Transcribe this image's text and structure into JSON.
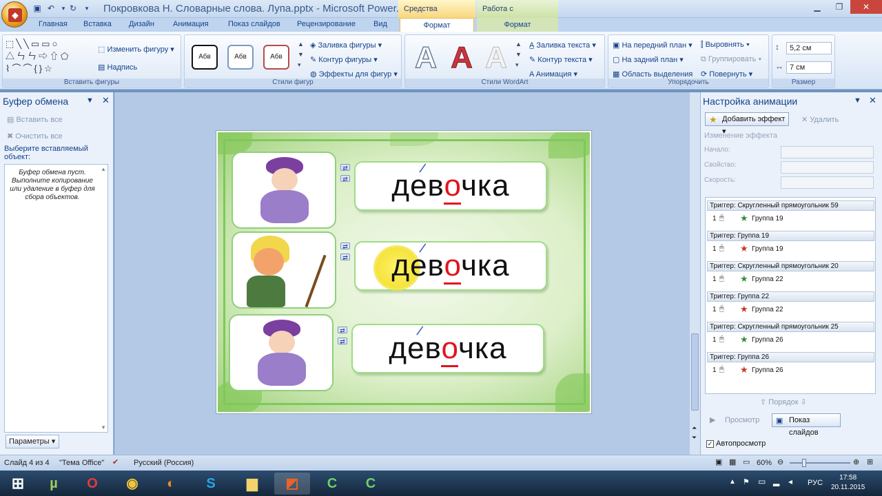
{
  "title_bar": {
    "title": "Покровкова Н. Словарные слова. Лупа.pptx - Microsoft Power...",
    "contextual_tab_drawing": "Средства рисования",
    "contextual_tab_picture": "Работа с рисунками"
  },
  "tabs": [
    "Главная",
    "Вставка",
    "Дизайн",
    "Анимация",
    "Показ слайдов",
    "Рецензирование",
    "Вид"
  ],
  "format_tab_a": "Формат",
  "format_tab_b": "Формат",
  "ribbon": {
    "insert_shapes": {
      "change_shape": "Изменить фигуру",
      "caption": "Надпись",
      "label": "Вставить фигуры"
    },
    "shape_styles": {
      "style_label": "Абв",
      "fill": "Заливка фигуры",
      "outline": "Контур фигуры",
      "effects": "Эффекты для фигур",
      "label": "Стили фигур"
    },
    "wordart": {
      "fill": "Заливка текста",
      "outline": "Контур текста",
      "animation": "Анимация",
      "label": "Стили WordArt"
    },
    "arrange": {
      "front": "На передний план",
      "back": "На задний план",
      "selection": "Область выделения",
      "align": "Выровнять",
      "group": "Группировать",
      "rotate": "Повернуть",
      "label": "Упорядочить"
    },
    "size": {
      "height": "5,2 см",
      "width": "7 см",
      "label": "Размер"
    }
  },
  "clipboard": {
    "header": "Буфер обмена",
    "paste_all": "Вставить все",
    "clear_all": "Очистить все",
    "choose": "Выберите вставляемый объект:",
    "empty_msg": "Буфер обмена пуст. Выполните копирование или удаление в буфер для сбора объектов.",
    "params": "Параметры"
  },
  "slide": {
    "words": [
      {
        "pre": "дев",
        "hl": "о",
        "post": "чка"
      },
      {
        "pre": "дев",
        "hl": "о",
        "post": "чка"
      },
      {
        "pre": "дев",
        "hl": "о",
        "post": "чка"
      }
    ]
  },
  "animation_pane": {
    "header": "Настройка анимации",
    "add_effect": "Добавить эффект",
    "remove": "Удалить",
    "change_effect": "Изменение эффекта",
    "start": "Начало:",
    "property": "Свойство:",
    "speed": "Скорость:",
    "triggers": [
      {
        "header": "Триггер: Скругленный прямоугольник 59",
        "num": "1",
        "group": "Группа 19",
        "type": "entrance"
      },
      {
        "header": "Триггер: Группа 19",
        "num": "1",
        "group": "Группа 19",
        "type": "exit"
      },
      {
        "header": "Триггер: Скругленный прямоугольник 20",
        "num": "1",
        "group": "Группа 22",
        "type": "entrance"
      },
      {
        "header": "Триггер: Группа 22",
        "num": "1",
        "group": "Группа 22",
        "type": "exit"
      },
      {
        "header": "Триггер: Скругленный прямоугольник 25",
        "num": "1",
        "group": "Группа 26",
        "type": "entrance"
      },
      {
        "header": "Триггер: Группа 26",
        "num": "1",
        "group": "Группа 26",
        "type": "exit"
      }
    ],
    "order": "Порядок",
    "preview": "Просмотр",
    "slideshow": "Показ слайдов",
    "autopreview": "Автопросмотр"
  },
  "status": {
    "slide": "Слайд 4 из 4",
    "theme": "\"Тема Office\"",
    "language": "Русский (Россия)",
    "zoom": "60%"
  },
  "taskbar": {
    "lang": "РУС",
    "time": "17:58",
    "date": "20.11.2015"
  },
  "colors": {
    "accent_red": "#e2141e",
    "entrance_star": "#3a8a3a",
    "exit_star": "#c0392b"
  }
}
